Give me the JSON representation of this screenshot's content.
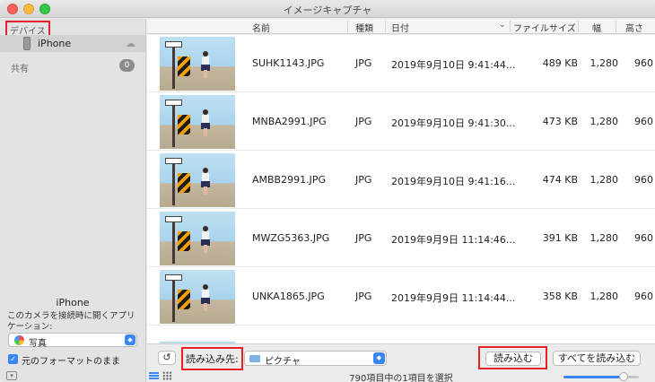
{
  "window": {
    "title": "イメージキャプチャ"
  },
  "sidebar": {
    "devices_heading": "デバイス",
    "device": {
      "name": "iPhone",
      "icon": "phone-icon",
      "eject_icon": "cloud-icon"
    },
    "shared_heading": "共有",
    "shared_count": "0",
    "device_title": "iPhone",
    "open_app_caption": "このカメラを接続時に開くアプリケーション:",
    "open_app_value": "写真",
    "keep_format_label": "元のフォーマットのまま",
    "keep_format_checked": true
  },
  "table": {
    "columns": {
      "name": "名前",
      "kind": "種類",
      "date": "日付",
      "size": "ファイルサイズ",
      "width": "幅",
      "height": "高さ"
    },
    "rows": [
      {
        "name": "SUHK1143.JPG",
        "kind": "JPG",
        "date": "2019年9月10日 9:41:44...",
        "size": "489 KB",
        "width": "1,280",
        "height": "960"
      },
      {
        "name": "MNBA2991.JPG",
        "kind": "JPG",
        "date": "2019年9月10日 9:41:30...",
        "size": "473 KB",
        "width": "1,280",
        "height": "960"
      },
      {
        "name": "AMBB2991.JPG",
        "kind": "JPG",
        "date": "2019年9月10日 9:41:16...",
        "size": "474 KB",
        "width": "1,280",
        "height": "960"
      },
      {
        "name": "MWZG5363.JPG",
        "kind": "JPG",
        "date": "2019年9月9日 11:14:46...",
        "size": "391 KB",
        "width": "1,280",
        "height": "960"
      },
      {
        "name": "UNKA1865.JPG",
        "kind": "JPG",
        "date": "2019年9月9日 11:14:44...",
        "size": "358 KB",
        "width": "1,280",
        "height": "960"
      }
    ]
  },
  "toolbar": {
    "rotate_label": "↺",
    "import_to_label": "読み込み先:",
    "destination_value": "ピクチャ",
    "import_button": "読み込む",
    "import_all_button": "すべてを読み込む",
    "status": "790項目中の1項目を選択",
    "thumbnail_zoom": 0.8
  },
  "colors": {
    "accent": "#3b86f7",
    "highlight_box": "#e8202a"
  }
}
